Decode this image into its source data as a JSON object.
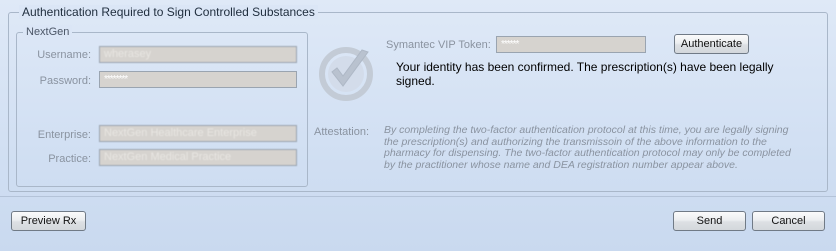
{
  "auth_group": {
    "title": "Authentication Required to Sign Controlled Substances"
  },
  "nextgen_group": {
    "title": "NextGen",
    "username": {
      "label": "Username:",
      "value": "wherasey"
    },
    "password": {
      "label": "Password:",
      "value": "********"
    },
    "enterprise": {
      "label": "Enterprise:",
      "value": "NextGen Healthcare Enterprise"
    },
    "practice": {
      "label": "Practice:",
      "value": "NextGen Medical Practice"
    }
  },
  "token": {
    "label": "Symantec VIP Token:",
    "value": "******"
  },
  "authenticate_button": "Authenticate",
  "confirmation": "Your identity has been confirmed.  The prescription(s) have been legally signed.",
  "attestation": {
    "label": "Attestation:",
    "text": "By completing the two-factor authentication protocol at this time, you are legally signing the prescription(s) and authorizing the transmissoin of the above information to the pharmacy for dispensing. The two-factor authentication protocol may only be completed by the practitioner whose name and DEA registration number appear above."
  },
  "footer": {
    "preview_button": "Preview Rx",
    "send_button": "Send",
    "cancel_button": "Cancel"
  },
  "icons": {
    "verified": "checkmark-badge-icon"
  }
}
